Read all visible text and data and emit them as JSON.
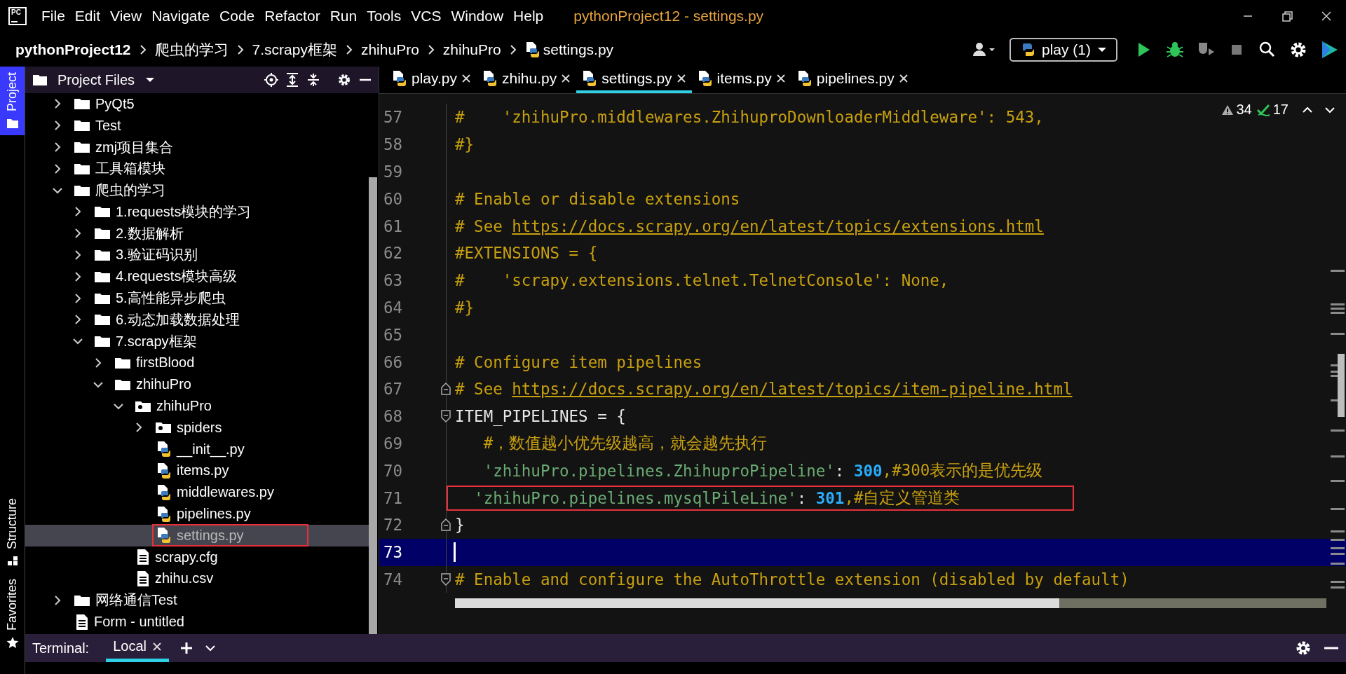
{
  "logo": {
    "text": "PC"
  },
  "menu": [
    "File",
    "Edit",
    "View",
    "Navigate",
    "Code",
    "Refactor",
    "Run",
    "Tools",
    "VCS",
    "Window",
    "Help"
  ],
  "window_title": "pythonProject12 - settings.py",
  "breadcrumb": [
    {
      "label": "pythonProject12",
      "kind": "project"
    },
    {
      "label": "爬虫的学习",
      "kind": "folder"
    },
    {
      "label": "7.scrapy框架",
      "kind": "folder"
    },
    {
      "label": "zhihuPro",
      "kind": "folder"
    },
    {
      "label": "zhihuPro",
      "kind": "folder"
    },
    {
      "label": "settings.py",
      "kind": "python"
    }
  ],
  "run_config": {
    "label": "play (1)"
  },
  "tool_stripe": [
    {
      "label": "Project",
      "selected": true,
      "kind": "project"
    },
    {
      "label": "Structure",
      "selected": false,
      "kind": "structure"
    },
    {
      "label": "Favorites",
      "selected": false,
      "kind": "favorites"
    }
  ],
  "project_panel": {
    "title": "Project Files",
    "tree": [
      {
        "label": "PyQt5",
        "kind": "folder",
        "expanded": false,
        "selected": false,
        "boxed": false
      },
      {
        "label": "Test",
        "kind": "folder",
        "expanded": false,
        "selected": false,
        "boxed": false
      },
      {
        "label": "zmj项目集合",
        "kind": "folder",
        "expanded": false,
        "selected": false,
        "boxed": false
      },
      {
        "label": "工具箱模块",
        "kind": "folder",
        "expanded": false,
        "selected": false,
        "boxed": false
      },
      {
        "label": "爬虫的学习",
        "kind": "folder",
        "expanded": true,
        "selected": false,
        "boxed": false,
        "children": [
          {
            "label": "1.requests模块的学习",
            "kind": "folder",
            "expanded": false,
            "selected": false,
            "boxed": false
          },
          {
            "label": "2.数据解析",
            "kind": "folder",
            "expanded": false,
            "selected": false,
            "boxed": false
          },
          {
            "label": "3.验证码识别",
            "kind": "folder",
            "expanded": false,
            "selected": false,
            "boxed": false
          },
          {
            "label": "4.requests模块高级",
            "kind": "folder",
            "expanded": false,
            "selected": false,
            "boxed": false
          },
          {
            "label": "5.高性能异步爬虫",
            "kind": "folder",
            "expanded": false,
            "selected": false,
            "boxed": false
          },
          {
            "label": "6.动态加载数据处理",
            "kind": "folder",
            "expanded": false,
            "selected": false,
            "boxed": false
          },
          {
            "label": "7.scrapy框架",
            "kind": "folder",
            "expanded": true,
            "selected": false,
            "boxed": false,
            "children": [
              {
                "label": "firstBlood",
                "kind": "folder",
                "expanded": false,
                "selected": false,
                "boxed": false
              },
              {
                "label": "zhihuPro",
                "kind": "folder",
                "expanded": true,
                "selected": false,
                "boxed": false,
                "children": [
                  {
                    "label": "zhihuPro",
                    "kind": "package",
                    "expanded": true,
                    "selected": false,
                    "boxed": false,
                    "children": [
                      {
                        "label": "spiders",
                        "kind": "package",
                        "expanded": false,
                        "selected": false,
                        "boxed": false
                      },
                      {
                        "label": "__init__.py",
                        "kind": "python",
                        "selected": false,
                        "boxed": false
                      },
                      {
                        "label": "items.py",
                        "kind": "python",
                        "selected": false,
                        "boxed": false
                      },
                      {
                        "label": "middlewares.py",
                        "kind": "python",
                        "selected": false,
                        "boxed": false
                      },
                      {
                        "label": "pipelines.py",
                        "kind": "python",
                        "selected": false,
                        "boxed": false
                      },
                      {
                        "label": "settings.py",
                        "kind": "python",
                        "selected": true,
                        "boxed": true
                      }
                    ]
                  },
                  {
                    "label": "scrapy.cfg",
                    "kind": "text",
                    "selected": false,
                    "boxed": false
                  },
                  {
                    "label": "zhihu.csv",
                    "kind": "text",
                    "selected": false,
                    "boxed": false
                  }
                ]
              }
            ]
          }
        ]
      },
      {
        "label": "网络通信Test",
        "kind": "folder",
        "expanded": false,
        "selected": false,
        "boxed": false
      },
      {
        "label": "Form - untitled",
        "kind": "text",
        "selected": false,
        "boxed": false
      }
    ]
  },
  "editor": {
    "tabs": [
      {
        "label": "play.py",
        "selected": false
      },
      {
        "label": "zhihu.py",
        "selected": false
      },
      {
        "label": "settings.py",
        "selected": true
      },
      {
        "label": "items.py",
        "selected": false
      },
      {
        "label": "pipelines.py",
        "selected": false
      }
    ],
    "inspections": {
      "warnings": "34",
      "passed": "17"
    },
    "lines": [
      {
        "number": "57",
        "current": false,
        "fold_start": false,
        "fold_end": false,
        "tokens": [
          {
            "kind": "comment",
            "text": "#    'zhihuPro.middlewares.ZhihuproDownloaderMiddleware': 543,"
          }
        ]
      },
      {
        "number": "58",
        "current": false,
        "fold_start": false,
        "fold_end": false,
        "tokens": [
          {
            "kind": "comment",
            "text": "#}"
          }
        ]
      },
      {
        "number": "59",
        "current": false,
        "fold_start": false,
        "fold_end": false
      },
      {
        "number": "60",
        "current": false,
        "fold_start": false,
        "fold_end": false,
        "tokens": [
          {
            "kind": "comment",
            "text": "# Enable or disable extensions"
          }
        ]
      },
      {
        "number": "61",
        "current": false,
        "fold_start": false,
        "fold_end": false,
        "tokens": [
          {
            "kind": "comment",
            "text": "# See "
          },
          {
            "kind": "link",
            "text": "https://docs.scrapy.org/en/latest/topics/extensions.html"
          }
        ]
      },
      {
        "number": "62",
        "current": false,
        "fold_start": false,
        "fold_end": false,
        "tokens": [
          {
            "kind": "comment",
            "text": "#EXTENSIONS = {"
          }
        ]
      },
      {
        "number": "63",
        "current": false,
        "fold_start": false,
        "fold_end": false,
        "tokens": [
          {
            "kind": "comment",
            "text": "#    'scrapy.extensions.telnet.TelnetConsole': None,"
          }
        ]
      },
      {
        "number": "64",
        "current": false,
        "fold_start": false,
        "fold_end": false,
        "tokens": [
          {
            "kind": "comment",
            "text": "#}"
          }
        ]
      },
      {
        "number": "65",
        "current": false,
        "fold_start": false,
        "fold_end": false
      },
      {
        "number": "66",
        "current": false,
        "fold_start": false,
        "fold_end": false,
        "tokens": [
          {
            "kind": "comment",
            "text": "# Configure item pipelines"
          }
        ]
      },
      {
        "number": "67",
        "current": false,
        "fold_start": false,
        "fold_end": true,
        "tokens": [
          {
            "kind": "comment",
            "text": "# See "
          },
          {
            "kind": "link",
            "text": "https://docs.scrapy.org/en/latest/topics/item-pipeline.html"
          }
        ]
      },
      {
        "number": "68",
        "current": false,
        "fold_start": true,
        "fold_end": false,
        "tokens": [
          {
            "kind": "plain",
            "text": "ITEM_PIPELINES = {"
          }
        ]
      },
      {
        "number": "69",
        "current": false,
        "fold_start": false,
        "fold_end": false,
        "tokens": [
          {
            "kind": "comment",
            "text": "   #，数值越小优先级越高，就会越先执行"
          }
        ]
      },
      {
        "number": "70",
        "current": false,
        "fold_start": false,
        "fold_end": false,
        "tokens": [
          {
            "kind": "string",
            "text": "   'zhihuPro.pipelines.ZhihuproPipeline'"
          },
          {
            "kind": "plain",
            "text": ": "
          },
          {
            "kind": "number",
            "text": "300"
          },
          {
            "kind": "comment",
            "text": ",#300表示的是优先级"
          }
        ]
      },
      {
        "number": "71",
        "current": false,
        "boxed": true,
        "fold_start": false,
        "fold_end": false,
        "tokens": [
          {
            "kind": "string",
            "text": "  'zhihuPro.pipelines.mysqlPileLine'"
          },
          {
            "kind": "plain",
            "text": ": "
          },
          {
            "kind": "number",
            "text": "301"
          },
          {
            "kind": "comment",
            "text": ",#自定义管道类"
          }
        ]
      },
      {
        "number": "72",
        "current": false,
        "fold_start": false,
        "fold_end": true,
        "tokens": [
          {
            "kind": "plain",
            "text": "}"
          }
        ]
      },
      {
        "number": "73",
        "current": true,
        "fold_start": false,
        "fold_end": false
      },
      {
        "number": "74",
        "current": false,
        "fold_start": true,
        "fold_end": false,
        "tokens": [
          {
            "kind": "comment",
            "text": "# Enable and configure the AutoThrottle extension (disabled by default)"
          }
        ]
      }
    ]
  },
  "terminal_bar": {
    "label": "Terminal:",
    "tabs": [
      {
        "label": "Local",
        "selected": true
      }
    ]
  }
}
